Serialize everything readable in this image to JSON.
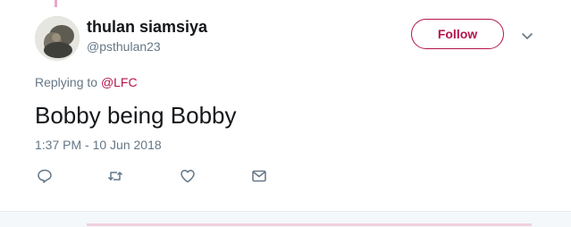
{
  "tweet": {
    "display_name": "thulan siamsiya",
    "handle": "@psthulan23",
    "follow_label": "Follow",
    "replying_prefix": "Replying to",
    "replying_to": "@LFC",
    "text": "Bobby being Bobby",
    "timestamp": "1:37 PM - 10 Jun 2018"
  },
  "icons": {
    "menu": "chevron-down-icon",
    "reply": "reply-icon",
    "retweet": "retweet-icon",
    "like": "heart-icon",
    "dm": "envelope-icon"
  },
  "colors": {
    "accent": "#b5134d",
    "secondary_text": "#657786",
    "primary_text": "#14171a"
  }
}
